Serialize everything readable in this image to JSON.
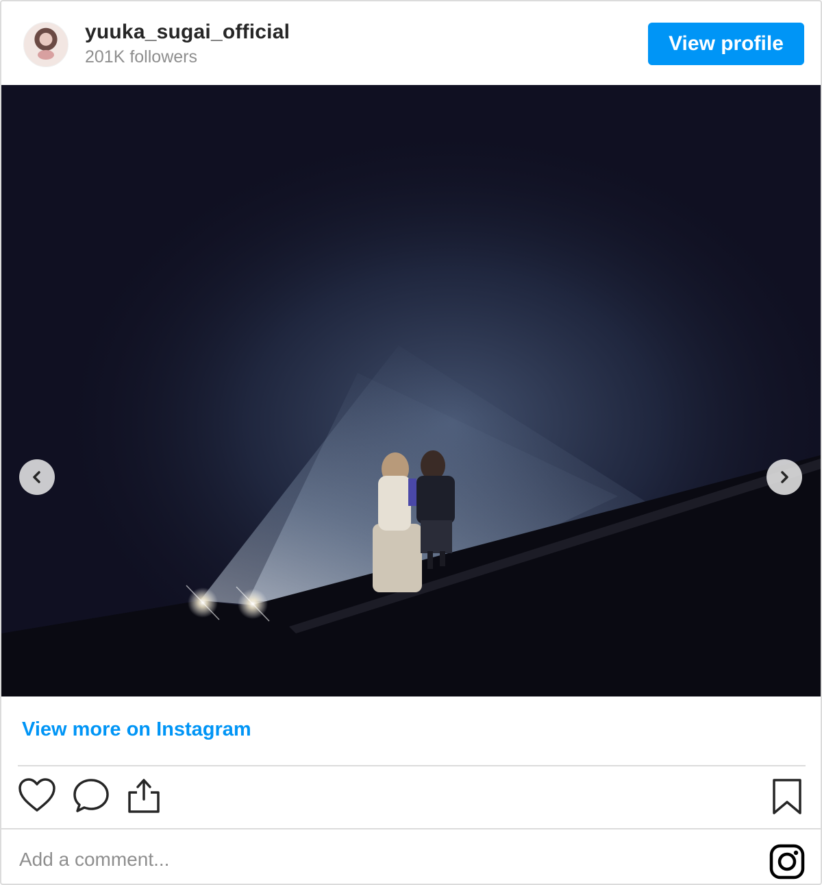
{
  "header": {
    "username": "yuuka_sugai_official",
    "followers": "201K followers",
    "view_profile_label": "View profile"
  },
  "carousel": {
    "slide_count": 3,
    "active_index": 1
  },
  "footer": {
    "view_more_label": "View more on Instagram",
    "comment_placeholder": "Add a comment..."
  },
  "icons": {
    "avatar": "avatar",
    "prev": "chevron-left-icon",
    "next": "chevron-right-icon",
    "like": "heart-icon",
    "comment": "comment-icon",
    "share": "share-icon",
    "bookmark": "bookmark-icon",
    "brand": "instagram-logo-icon"
  },
  "colors": {
    "accent": "#0095f6",
    "muted_text": "#8e8e8e",
    "divider": "#dbdbdb"
  }
}
